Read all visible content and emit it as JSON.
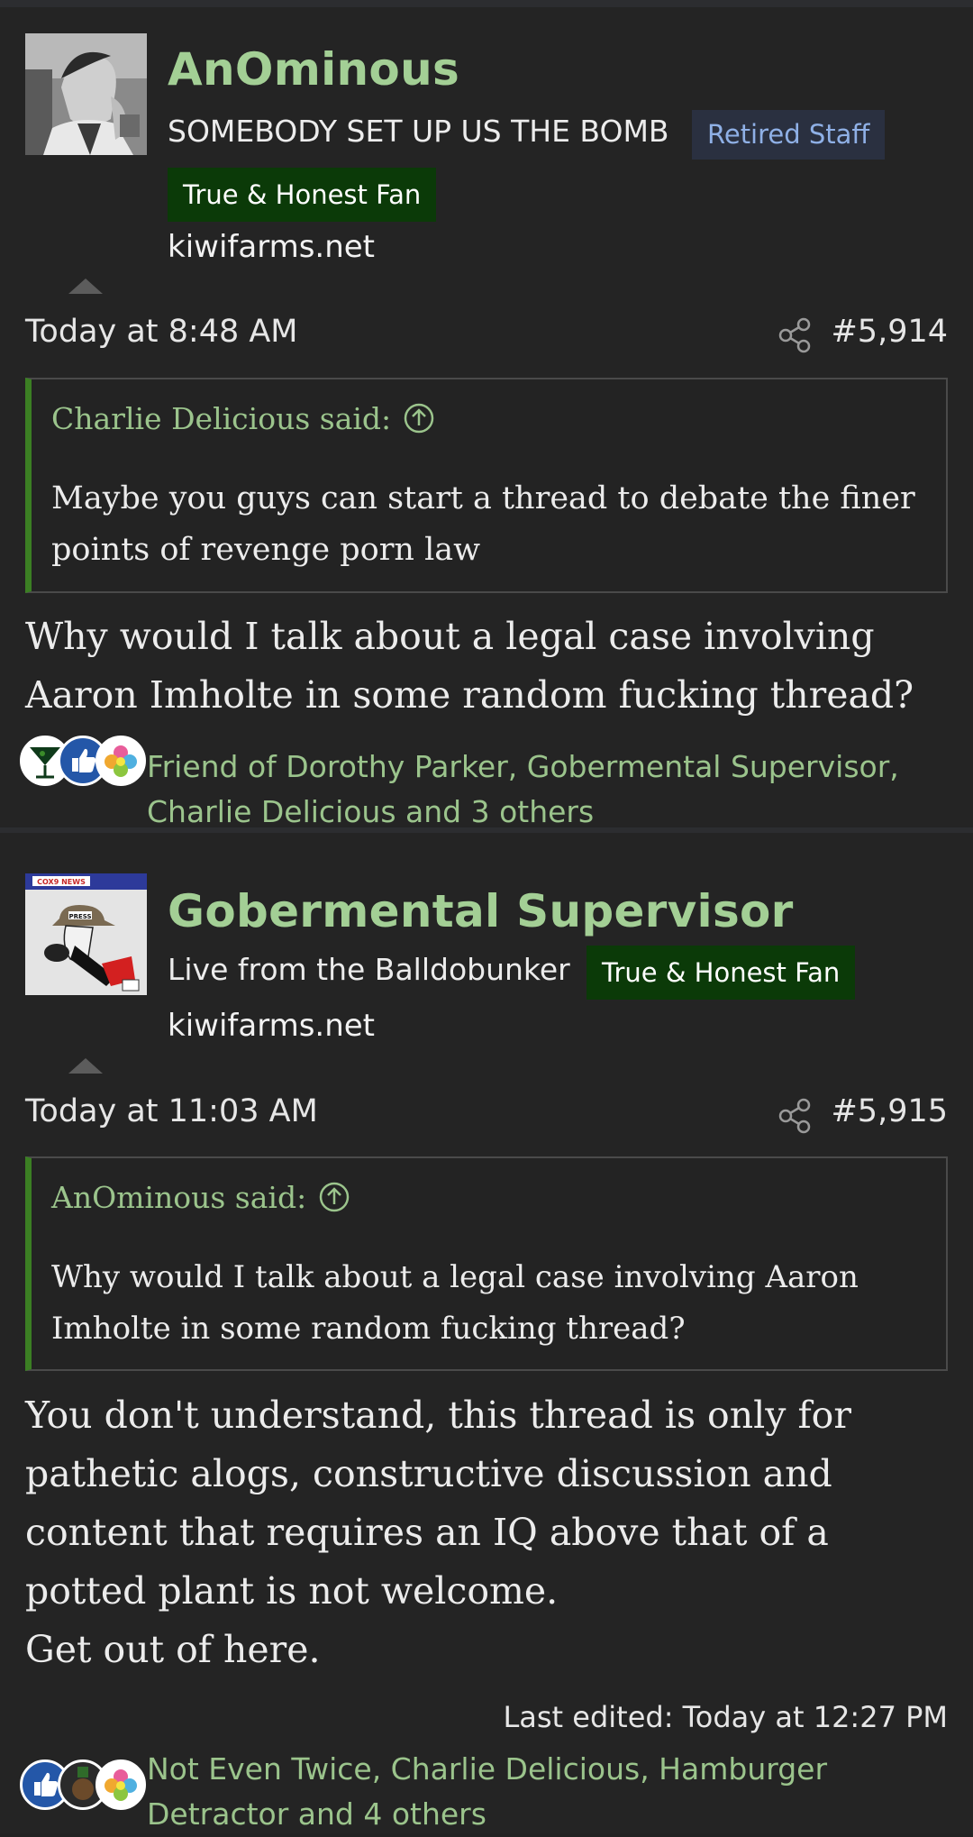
{
  "posts": [
    {
      "username": "AnOminous",
      "user_title": "SOMEBODY SET UP US THE BOMB",
      "staff_badge": "Retired Staff",
      "fan_badge": "True & Honest Fan",
      "site": "kiwifarms.net",
      "date": "Today at 8:48 AM",
      "post_number": "#5,914",
      "quote": {
        "attribution": "Charlie Delicious said:",
        "text": "Maybe you guys can start a thread to debate the finer points of revenge porn law"
      },
      "body": "Why would I talk about a legal case involving Aaron Imholte in some random fucking thread?",
      "reactions": {
        "icons": [
          "martini-icon",
          "thumbs-up-icon",
          "flower-icon"
        ],
        "names": "Friend of Dorothy Parker, Gobermental Supervisor, Charlie Delicious and 3 others"
      }
    },
    {
      "username": "Gobermental Supervisor",
      "user_title": "Live from the Balldobunker",
      "fan_badge": "True & Honest Fan",
      "site": "kiwifarms.net",
      "avatar_caption": "COX9 NEWS",
      "avatar_hat_text": "PRESS",
      "date": "Today at 11:03 AM",
      "post_number": "#5,915",
      "quote": {
        "attribution": "AnOminous said:",
        "text": "Why would I talk about a legal case involving Aaron Imholte in some random fucking thread?"
      },
      "body": "You don't understand, this thread is only for pathetic alogs, constructive discussion and content that requires an IQ above that of a potted plant is not welcome.\nGet out of here.",
      "last_edited": "Last edited: Today at 12:27 PM",
      "reactions": {
        "icons": [
          "thumbs-up-icon",
          "medal-icon",
          "flower-icon"
        ],
        "names": "Not Even Twice, Charlie Delicious, Hamburger Detractor and 4 others"
      }
    }
  ],
  "colors": {
    "username": "#a3cf95",
    "quote_border": "#3b7f23",
    "fan_badge_bg": "#0b3a08",
    "staff_badge_bg": "#2a3040",
    "background": "#242424"
  }
}
